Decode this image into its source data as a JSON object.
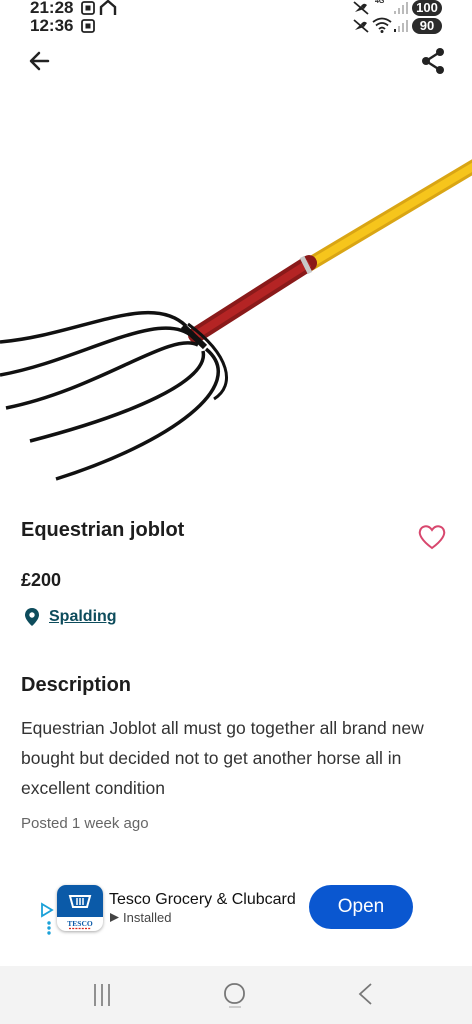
{
  "status_bar": {
    "top_time": "21:28",
    "bottom_time": "12:36",
    "battery_top": "100",
    "battery_bottom": "90",
    "network_label": "4G"
  },
  "toolbar": {
    "back_icon": "arrow-left-icon",
    "share_icon": "share-icon"
  },
  "listing": {
    "title": "Equestrian joblot",
    "price": "£200",
    "location": "Spalding",
    "description_heading": "Description",
    "description": "Equestrian Joblot all must go together  all brand new bought but decided not to get another horse all in excellent condition",
    "posted": "Posted 1 week ago"
  },
  "ad": {
    "app_name": "Tesco Grocery & Clubcard",
    "status": "Installed",
    "open_label": "Open",
    "icon_text": "TESCO",
    "accent_color": "#0a57d0"
  },
  "colors": {
    "location_link": "#0d4c5c",
    "favorite_outline": "#d8476e",
    "open_button": "#0a57d0"
  }
}
